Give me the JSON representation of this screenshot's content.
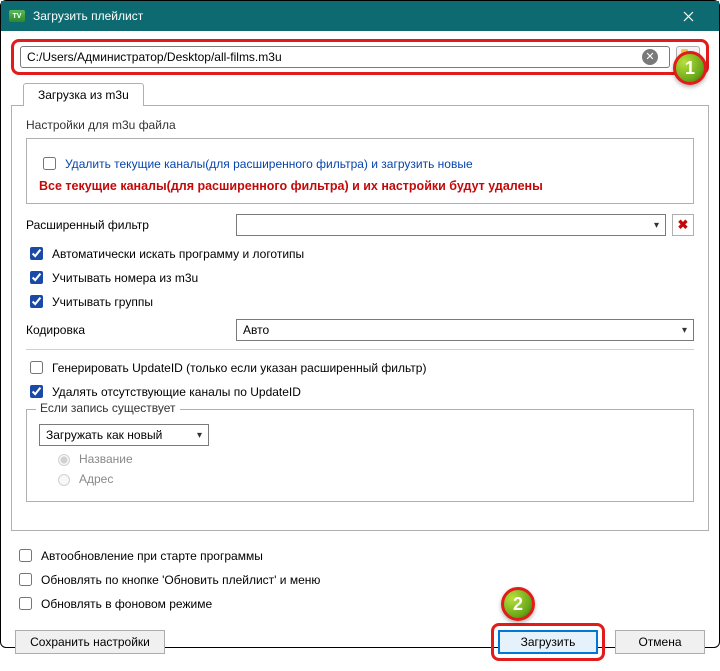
{
  "title": "Загрузить плейлист",
  "markers": {
    "one": "1",
    "two": "2"
  },
  "path_value": "C:/Users/Администратор/Desktop/all-films.m3u",
  "tab_label": "Загрузка из m3u",
  "group_settings": "Настройки для m3u файла",
  "checkbox_delete_load": "Удалить текущие каналы(для расширенного фильтра) и загрузить новые",
  "warning": "Все текущие каналы(для расширенного фильтра) и их настройки будут удалены",
  "ext_filter_label": "Расширенный фильтр",
  "ext_filter_value": "",
  "cb_auto_search": "Автоматически искать программу и логотипы",
  "cb_use_numbers": "Учитывать номера из m3u",
  "cb_use_groups": "Учитывать группы",
  "encoding_label": "Кодировка",
  "encoding_value": "Авто",
  "cb_generate_id": "Генерировать UpdateID (только если указан расширенный фильтр)",
  "cb_delete_missing": "Удалять отсутствующие каналы по UpdateID",
  "exists_legend": "Если запись существует",
  "exists_select": "Загружать как новый",
  "radio_name": "Название",
  "radio_address": "Адрес",
  "cb_autoupdate": "Автообновление при старте программы",
  "cb_update_button": "Обновлять по кнопке 'Обновить плейлист' и меню",
  "cb_update_bg": "Обновлять в фоновом режиме",
  "btn_save": "Сохранить настройки",
  "btn_load": "Загрузить",
  "btn_cancel": "Отмена"
}
